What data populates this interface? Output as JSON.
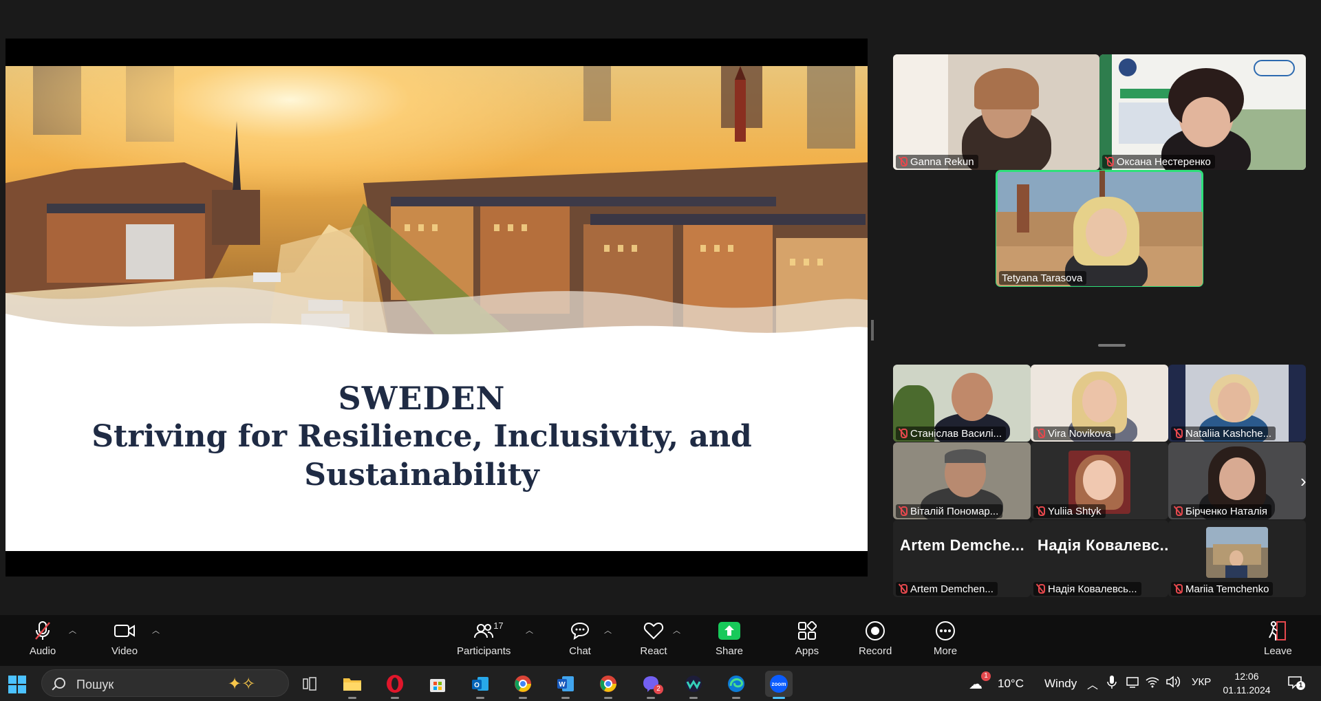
{
  "slide": {
    "title_line1": "SWEDEN",
    "title_line2": "Striving for Resilience, Inclusivity, and",
    "title_line3": "Sustainability"
  },
  "speaker_tiles": [
    {
      "name": "Ganna Rekun"
    },
    {
      "name": "Оксана Нестеренко"
    },
    {
      "name": "Tetyana Tarasova"
    }
  ],
  "gallery_tiles": [
    {
      "name": "Станіслав Василі..."
    },
    {
      "name": "Vira Novikova"
    },
    {
      "name": "Nataliia Kashche..."
    },
    {
      "name": "Віталій Пономар..."
    },
    {
      "name": "Yuliia Shtyk"
    },
    {
      "name": "Бірченко Наталія"
    },
    {
      "name": "Artem Demchen...",
      "big_name": "Artem Demche..."
    },
    {
      "name": "Надія Ковалевсь...",
      "big_name": "Надія Ковалевс..."
    },
    {
      "name": "Mariia Temchenko"
    }
  ],
  "toolbar": {
    "audio": "Audio",
    "video": "Video",
    "participants": "Participants",
    "participants_count": "17",
    "chat": "Chat",
    "react": "React",
    "share": "Share",
    "apps": "Apps",
    "record": "Record",
    "more": "More",
    "leave": "Leave"
  },
  "taskbar": {
    "search_placeholder": "Пошук",
    "weather_temp": "10°C",
    "weather_desc": "Windy",
    "weather_badge": "1",
    "language": "УКР",
    "time": "12:06",
    "date": "01.11.2024",
    "notification_count": "1",
    "viber_badge": "2"
  },
  "colors": {
    "active_speaker_border": "#2ee07a",
    "share_button": "#18c95a",
    "muted_red": "#e5484d",
    "slide_title": "#1f2b44"
  }
}
